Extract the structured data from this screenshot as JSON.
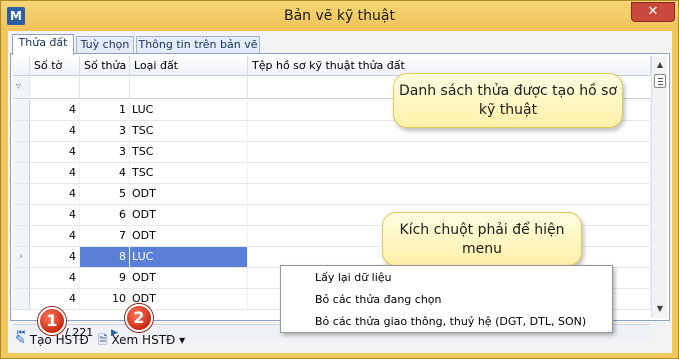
{
  "window": {
    "title": "Bản vẽ kỹ thuật",
    "close_label": "✕",
    "app_icon": "map-app-icon"
  },
  "tabs": [
    {
      "label": "Thửa đất",
      "active": true
    },
    {
      "label": "Tuỳ chọn",
      "active": false
    },
    {
      "label": "Thông tin trên bản vẽ",
      "active": false
    }
  ],
  "grid": {
    "columns": [
      "Số tờ",
      "Số thửa",
      "Loại đất",
      "Tệp hồ sơ kỹ thuật thửa đất"
    ],
    "rows": [
      {
        "so_to": "4",
        "so_thua": "1",
        "loai_dat": "LUC"
      },
      {
        "so_to": "4",
        "so_thua": "3",
        "loai_dat": "TSC"
      },
      {
        "so_to": "4",
        "so_thua": "3",
        "loai_dat": "TSC"
      },
      {
        "so_to": "4",
        "so_thua": "4",
        "loai_dat": "TSC"
      },
      {
        "so_to": "4",
        "so_thua": "5",
        "loai_dat": "ODT"
      },
      {
        "so_to": "4",
        "so_thua": "6",
        "loai_dat": "ODT"
      },
      {
        "so_to": "4",
        "so_thua": "7",
        "loai_dat": "ODT"
      },
      {
        "so_to": "4",
        "so_thua": "8",
        "loai_dat": "LUC",
        "selected": true
      },
      {
        "so_to": "4",
        "so_thua": "9",
        "loai_dat": "ODT"
      },
      {
        "so_to": "4",
        "so_thua": "10",
        "loai_dat": "ODT"
      }
    ]
  },
  "navigator": {
    "first": "⏮",
    "count": "/ 221",
    "next": "▶"
  },
  "toolbar": {
    "create_label": "Tạo HSTĐ",
    "view_label": "Xem HSTĐ",
    "view_arrow": "▾"
  },
  "markers": {
    "one": "1",
    "two": "2"
  },
  "callouts": {
    "list": "Danh sách thửa được tạo hồ sơ kỹ thuật",
    "right_click": "Kích chuột phải để hiện menu"
  },
  "context_menu": {
    "items": [
      "Lấy lại dữ liệu",
      "Bỏ các thửa đang chọn",
      "Bỏ các thửa giao thông, thuỷ hệ (DGT, DTL, SON)"
    ]
  }
}
